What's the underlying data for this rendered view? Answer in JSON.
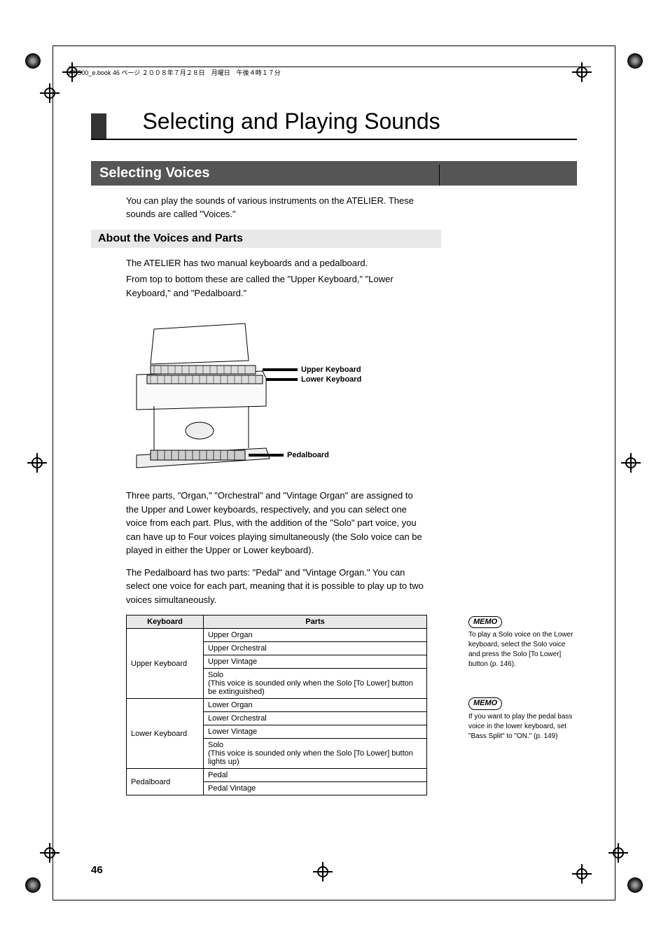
{
  "header": "AT-500_e.book  46 ページ  ２００８年７月２８日　月曜日　午後４時１７分",
  "chapter_title": "Selecting and Playing Sounds",
  "section_title": "Selecting Voices",
  "intro": "You can play the sounds of various instruments on the ATELIER. These sounds are called \"Voices.\"",
  "subsection_title": "About the Voices and Parts",
  "body1": "The ATELIER has two manual keyboards and a pedalboard.",
  "body2": "From top to bottom these are called the \"Upper Keyboard,\" \"Lower Keyboard,\" and \"Pedalboard.\"",
  "diagram_labels": {
    "upper": "Upper Keyboard",
    "lower": "Lower Keyboard",
    "pedal": "Pedalboard"
  },
  "body3": "Three parts, \"Organ,\"  \"Orchestral\" and \"Vintage Organ\" are assigned to the Upper and Lower keyboards, respectively, and you can select one voice from each part. Plus, with the addition of the \"Solo\" part voice, you can have up to Four voices playing simultaneously (the Solo voice can be played in either the Upper or Lower keyboard).",
  "body4": "The Pedalboard has two parts: \"Pedal\" and \"Vintage Organ.\" You can select one voice for each part, meaning that it is possible to play up to two voices simultaneously.",
  "table": {
    "head_keyboard": "Keyboard",
    "head_parts": "Parts",
    "rows": [
      {
        "keyboard": "Upper Keyboard",
        "parts": [
          "Upper Organ",
          "Upper Orchestral",
          "Upper Vintage",
          "Solo\n(This voice is sounded only when the Solo [To Lower] button be extinguished)"
        ]
      },
      {
        "keyboard": "Lower Keyboard",
        "parts": [
          "Lower Organ",
          "Lower Orchestral",
          "Lower Vintage",
          "Solo\n(This voice is sounded only when the Solo [To Lower] button lights up)"
        ]
      },
      {
        "keyboard": "Pedalboard",
        "parts": [
          "Pedal",
          "Pedal Vintage"
        ]
      }
    ]
  },
  "memo1": "To play a Solo voice on the Lower keyboard, select the Solo voice and press the Solo [To Lower] button (p. 146).",
  "memo2": "If you want to play the pedal bass voice in the lower keyboard, set \"Bass Split\" to \"ON.\" (p. 149)",
  "memo_label": "MEMO",
  "page_number": "46"
}
